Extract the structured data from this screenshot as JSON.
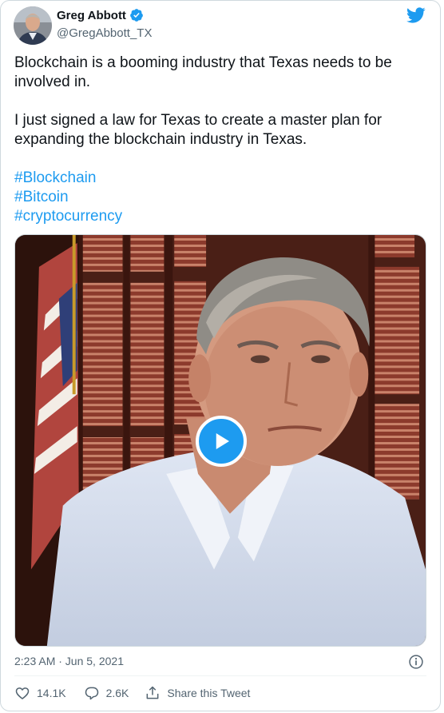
{
  "author": {
    "display_name": "Greg Abbott",
    "handle": "@GregAbbott_TX",
    "verified": true
  },
  "tweet": {
    "paragraphs": [
      "Blockchain is a booming industry that Texas needs to be involved in.",
      "I just signed a law for Texas to create a master plan for expanding the blockchain industry in Texas."
    ],
    "hashtags": [
      "#Blockchain",
      "#Bitcoin",
      "#cryptocurrency"
    ],
    "timestamp": "2:23 AM · Jun 5, 2021"
  },
  "media": {
    "type": "video",
    "play_icon": "play-icon"
  },
  "actions": {
    "likes": "14.1K",
    "replies": "2.6K",
    "share_label": "Share this Tweet"
  },
  "colors": {
    "accent": "#1d9bf0",
    "text": "#0f1419",
    "secondary": "#536471",
    "border": "#cfd9de"
  }
}
